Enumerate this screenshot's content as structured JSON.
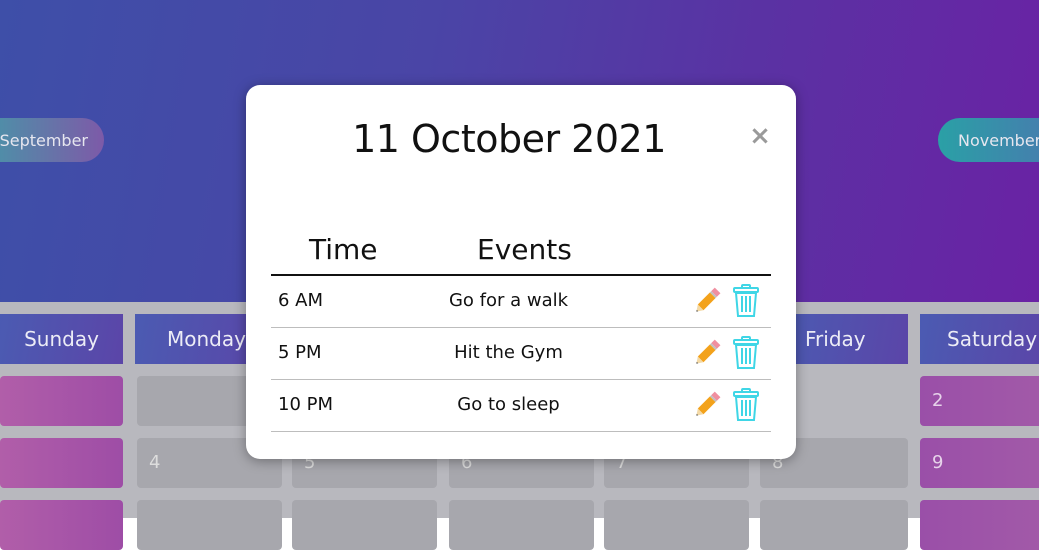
{
  "nav": {
    "prev_month": "September",
    "next_month": "November"
  },
  "weekdays": [
    "Sunday",
    "Monday",
    "Friday",
    "Saturday"
  ],
  "calendar_cells": {
    "saturday_row1": "2",
    "monday_row2": "4",
    "tuesday_row2": "5",
    "wednesday_row2": "6",
    "thursday_row2": "7",
    "friday_row2": "8",
    "saturday_row2": "9"
  },
  "modal": {
    "title": "11 October 2021",
    "close_label": "×",
    "headers": {
      "time": "Time",
      "events": "Events"
    },
    "events": [
      {
        "time": "6 AM",
        "event": "Go for a walk"
      },
      {
        "time": "5 PM",
        "event": "Hit the Gym"
      },
      {
        "time": "10 PM",
        "event": "Go to sleep"
      }
    ]
  },
  "icons": {
    "edit": "pencil-icon",
    "delete": "trash-icon"
  },
  "colors": {
    "header_start": "#3e4fa8",
    "header_end": "#6a22a4",
    "trash": "#3fd6e6",
    "pencil": "#f3a21b"
  }
}
